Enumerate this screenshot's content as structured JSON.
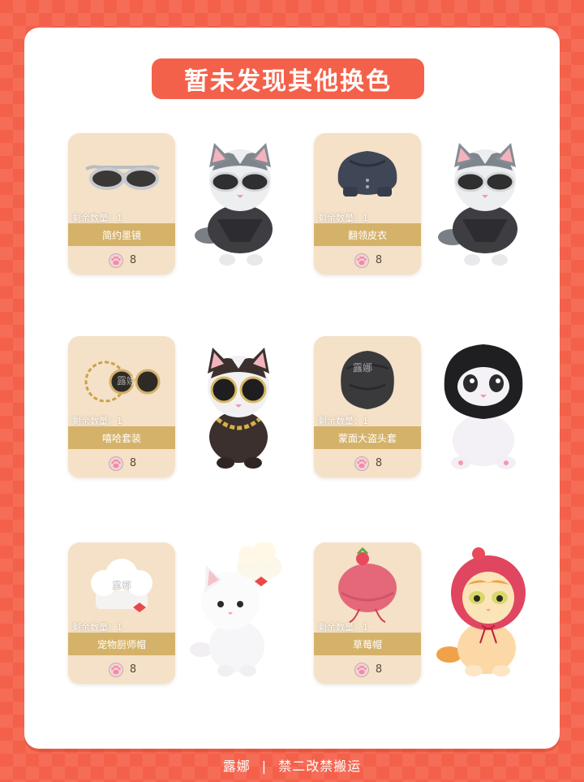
{
  "title": "暂未发现其他换色",
  "footer": {
    "author": "露娜",
    "separator": "|",
    "notice": "禁二改禁搬运"
  },
  "watermark": "露娜",
  "colors": {
    "background": "#f4614a",
    "card": "#f4e1c7",
    "namebar": "#d5b26a"
  },
  "items": [
    {
      "name": "简约墨镜",
      "quantity": "剩余数量：1",
      "price": "8",
      "icon": "sunglasses-icon"
    },
    {
      "name": "翻领皮衣",
      "quantity": "剩余数量：1",
      "price": "8",
      "icon": "leather-jacket-icon"
    },
    {
      "name": "嘻哈套装",
      "quantity": "剩余数量：1",
      "price": "8",
      "icon": "hiphop-glasses-icon"
    },
    {
      "name": "蒙面大盗头套",
      "quantity": "剩余数量：1",
      "price": "8",
      "icon": "balaclava-icon"
    },
    {
      "name": "宠物厨师帽",
      "quantity": "剩余数量：1",
      "price": "8",
      "icon": "chef-hat-icon"
    },
    {
      "name": "草莓帽",
      "quantity": "剩余数量：1",
      "price": "8",
      "icon": "strawberry-hat-icon"
    }
  ]
}
